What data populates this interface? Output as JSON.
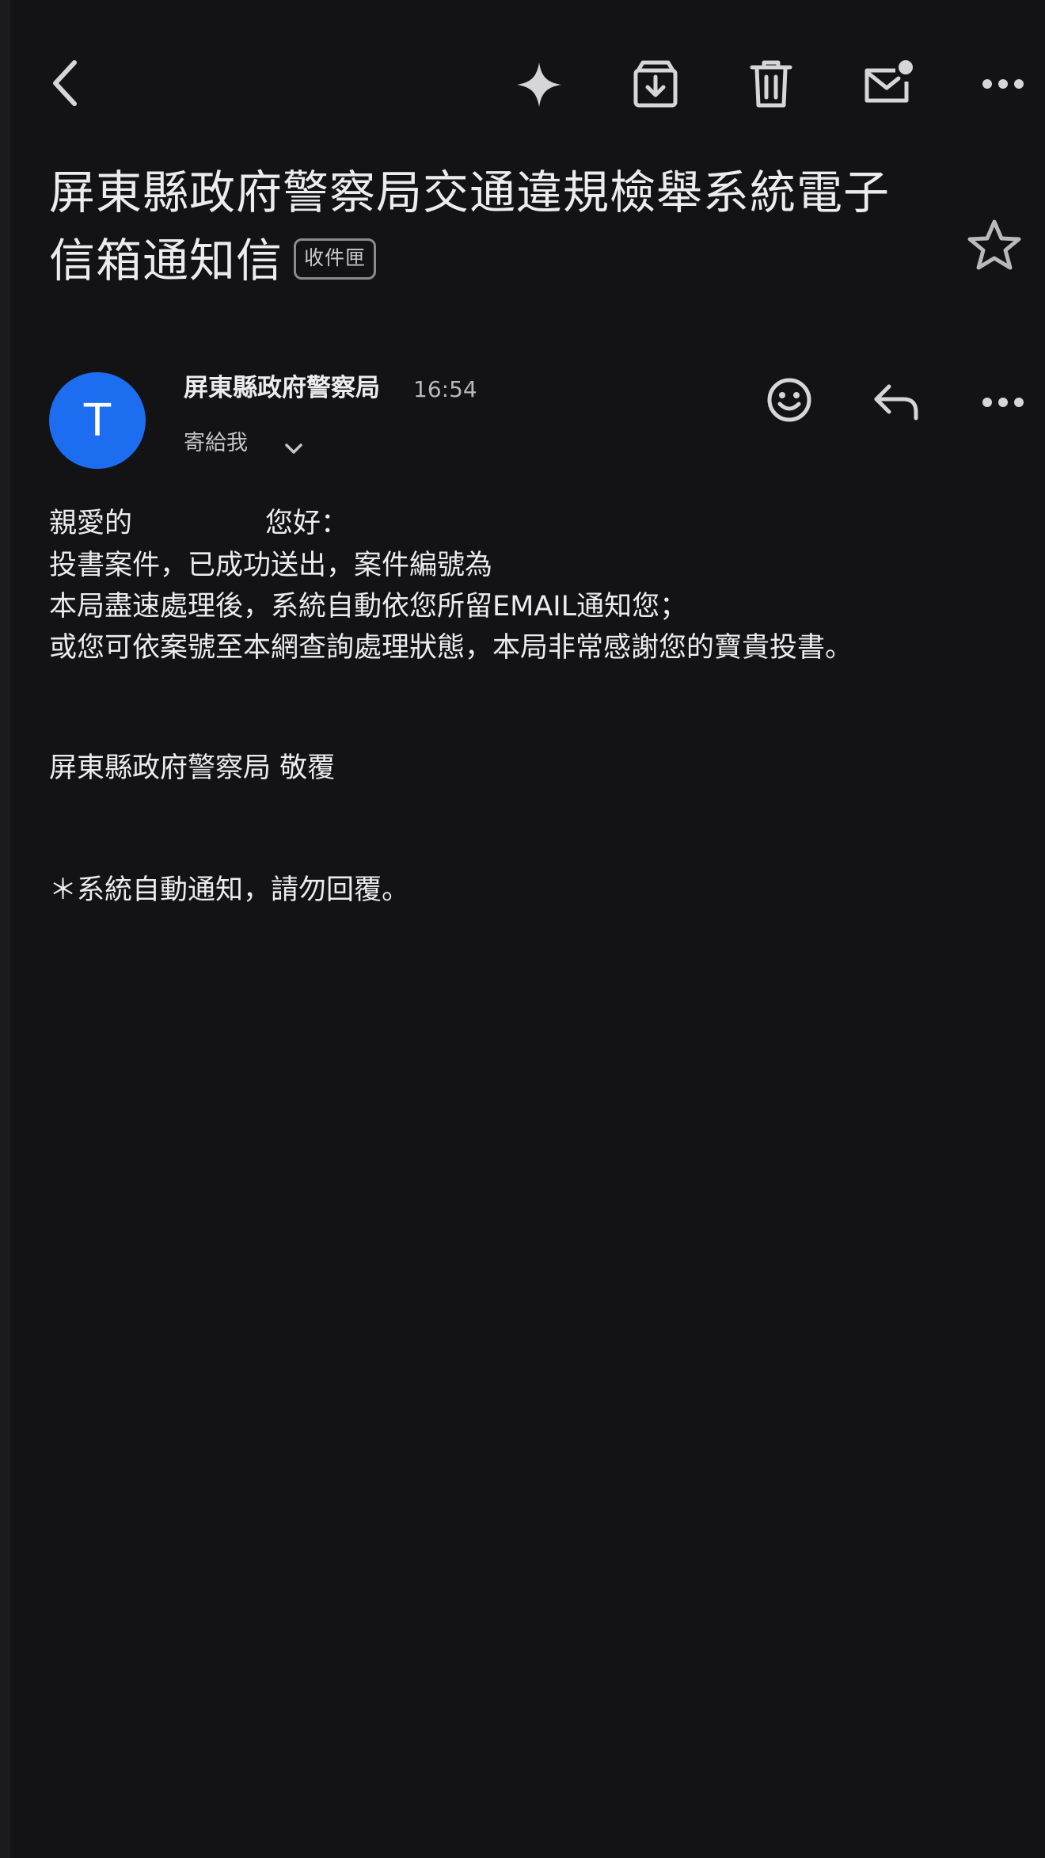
{
  "toolbar": {
    "back_icon": "chevron-left-icon",
    "ai_icon": "sparkle-icon",
    "archive_icon": "archive-icon",
    "delete_icon": "trash-icon",
    "mark_unread_icon": "mail-unread-icon",
    "more_icon": "more-horizontal-icon"
  },
  "email": {
    "subject": "屏東縣政府警察局交通違規檢舉系統電子信箱通知信",
    "label": "收件匣",
    "sender": {
      "avatar_letter": "T",
      "avatar_color": "#1c6df0",
      "name": "屏東縣政府警察局",
      "time": "16:54",
      "recipient": "寄給我"
    },
    "body": {
      "greeting_prefix": "親愛的",
      "greeting_suffix": "您好：",
      "line2": "投書案件，已成功送出，案件編號為",
      "line3": "本局盡速處理後，系統自動依您所留EMAIL通知您；",
      "line4": "或您可依案號至本網查詢處理狀態，本局非常感謝您的寶貴投書。",
      "signature": "屏東縣政府警察局 敬覆",
      "footnote": "＊系統自動通知，請勿回覆。"
    }
  },
  "colors": {
    "background": "#131316",
    "text": "#ececee",
    "muted": "#b8b8bd",
    "accent": "#1c6df0"
  }
}
